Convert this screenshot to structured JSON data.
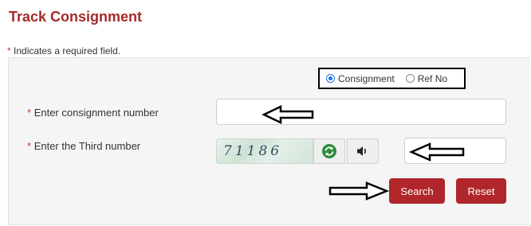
{
  "title": "Track Consignment",
  "required_note": {
    "star": "*",
    "text": "Indicates a required field."
  },
  "search_type": {
    "selected": "Consignment",
    "options": [
      {
        "label": "Consignment",
        "selected": true
      },
      {
        "label": "Ref No",
        "selected": false
      }
    ]
  },
  "fields": {
    "consignment": {
      "star": "*",
      "label": "Enter consignment number",
      "value": ""
    },
    "third_number": {
      "star": "*",
      "label": "Enter the Third number",
      "value": ""
    }
  },
  "captcha": {
    "text": "71186",
    "refresh_icon": "refresh-icon",
    "audio_icon": "speaker-icon"
  },
  "buttons": {
    "search": "Search",
    "reset": "Reset"
  },
  "colors": {
    "title": "#a52a2a",
    "button": "#b0262b",
    "required_star": "#c0392b",
    "radio_selected": "#1a73e8",
    "refresh_icon": "#2e8b3a"
  },
  "annotations": [
    "arrow-left",
    "arrow-left",
    "arrow-right"
  ]
}
